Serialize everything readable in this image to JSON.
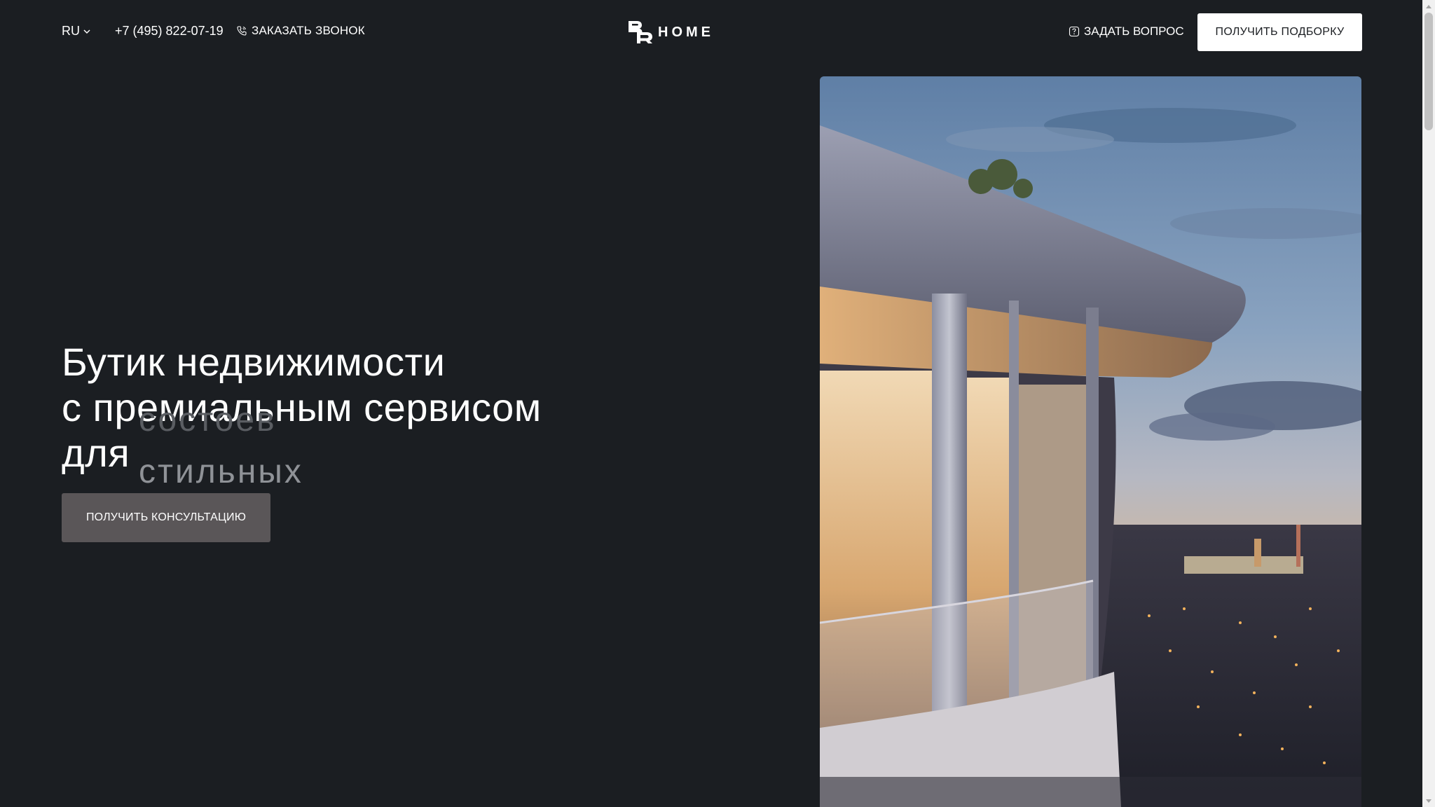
{
  "header": {
    "language": "RU",
    "phone": "+7 (495) 822-07-19",
    "callback_label": "ЗАКАЗАТЬ ЗВОНОК",
    "logo_text": "HOME",
    "ask_label": "ЗАДАТЬ ВОПРОС",
    "selection_button": "ПОЛУЧИТЬ ПОДБОРКУ"
  },
  "hero": {
    "title_line1": "Бутик недвижимости",
    "title_line2": "с премиальным сервисом",
    "title_line3": "для",
    "rotating_word_prev": "состоев",
    "rotating_word_current": "стильных",
    "consult_button": "ПОЛУЧИТЬ КОНСУЛЬТАЦИЮ"
  },
  "icons": {
    "language_chevron": "chevron-down-icon",
    "callback": "phone-icon",
    "ask": "question-icon",
    "logo": "br-logo-icon"
  },
  "colors": {
    "background": "#1b1e22",
    "text": "#ffffff",
    "consult_button": "#5a5658",
    "selection_button_bg": "#ffffff",
    "rotating_word": "#8f9297"
  }
}
